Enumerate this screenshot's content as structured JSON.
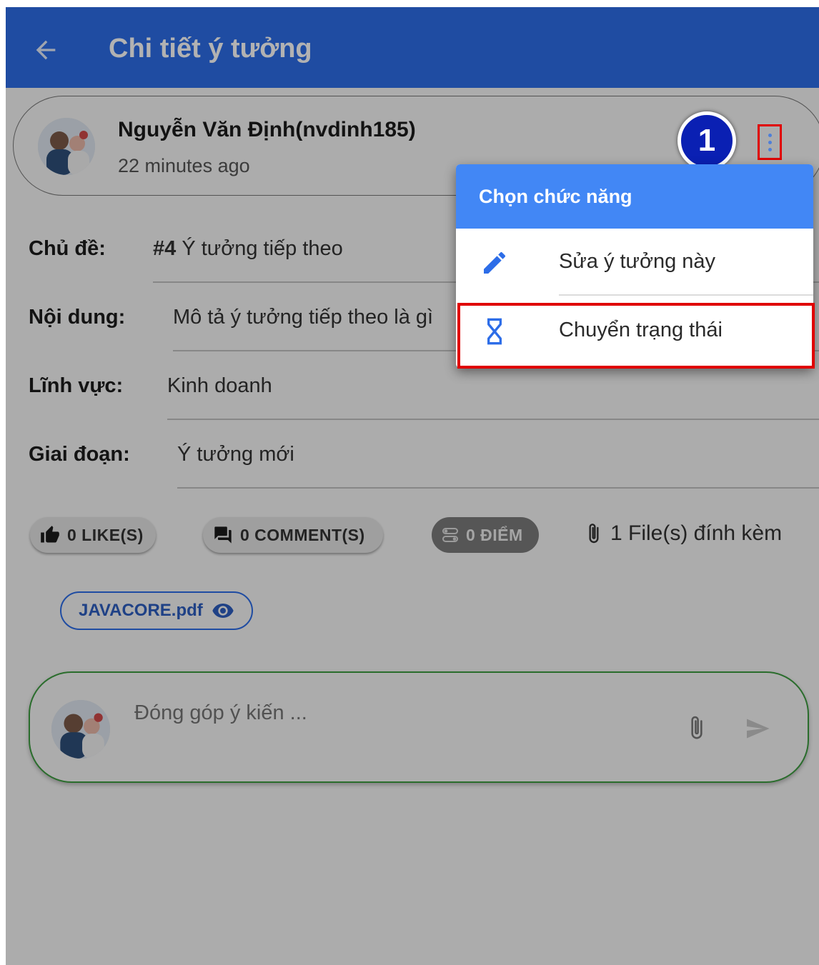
{
  "appbar": {
    "title": "Chi tiết ý tưởng"
  },
  "author": {
    "name": "Nguyễn Văn Định(nvdinh185)",
    "time": "22 minutes ago"
  },
  "annotation": {
    "step_number": "1"
  },
  "fields": {
    "topic": {
      "label": "Chủ đề:",
      "number": "#4",
      "value": "Ý tưởng tiếp theo"
    },
    "content": {
      "label": "Nội dung:",
      "value": "Mô tả ý tưởng tiếp theo là gì"
    },
    "domain": {
      "label": "Lĩnh vực:",
      "value": "Kinh doanh"
    },
    "stage": {
      "label": "Giai đoạn:",
      "value": "Ý tưởng mới"
    }
  },
  "stats": {
    "likes": "0 LIKE(S)",
    "comments": "0 COMMENT(S)",
    "points": "0 ĐIỂM",
    "attachments": "1 File(s) đính kèm"
  },
  "file": {
    "name": "JAVACORE.pdf"
  },
  "comment": {
    "placeholder": "Đóng góp ý kiến ..."
  },
  "menu": {
    "header": "Chọn chức năng",
    "items": [
      {
        "label": "Sửa ý tưởng này",
        "icon": "pencil-icon"
      },
      {
        "label": "Chuyển trạng thái",
        "icon": "hourglass-icon"
      }
    ]
  },
  "colors": {
    "primary": "#2d6de8",
    "menu_header": "#4287f5",
    "highlight": "#e00000",
    "comment_border": "#3d9c40"
  }
}
